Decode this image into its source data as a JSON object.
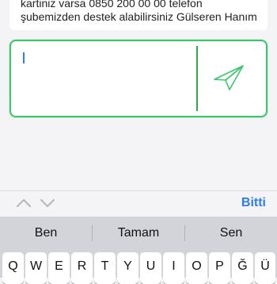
{
  "chat": {
    "line1": "kartiniz varsa 0850 200 00 00 telefon",
    "line2": "şubemizden destek alabilirsiniz Gülseren Hanım."
  },
  "message_input": {
    "value": ""
  },
  "icons": {
    "send": "send-paper-plane-icon",
    "prev": "chevron-up-icon",
    "next": "chevron-down-icon"
  },
  "colors": {
    "accent_green": "#3fc46e",
    "keyboard_blue": "#2f7cf6"
  },
  "toolbar": {
    "done_label": "Bitti"
  },
  "keyboard": {
    "suggestions": [
      "Ben",
      "Tamam",
      "Sen"
    ],
    "row1": [
      "Q",
      "W",
      "E",
      "R",
      "T",
      "Y",
      "U",
      "I",
      "O",
      "P",
      "Ğ",
      "Ü"
    ]
  }
}
